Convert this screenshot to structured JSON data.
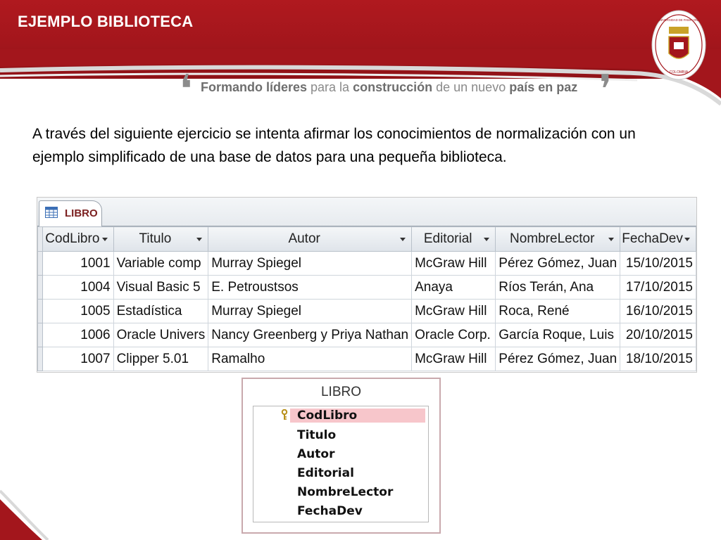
{
  "slide": {
    "title": "EJEMPLO BIBLIOTECA",
    "slogan": {
      "open_quote": "❛",
      "close_quote": "❜",
      "parts": [
        "Formando líderes",
        " para la ",
        "construcción",
        " de un nuevo ",
        "país en paz"
      ]
    },
    "seal_text": [
      "UNIVERSIDAD DE PAMPLONA",
      "COLOMBIA"
    ],
    "intro": "A través del siguiente ejercicio se intenta afirmar los conocimientos de normalización con un ejemplo simplificado de una base de datos para una pequeña biblioteca."
  },
  "table": {
    "tab_label": "LIBRO",
    "tab_icon": "datasheet-table-icon",
    "columns": [
      "CodLibro",
      "Titulo",
      "Autor",
      "Editorial",
      "NombreLector",
      "FechaDev"
    ],
    "rows": [
      [
        "1001",
        "Variable comp",
        "Murray Spiegel",
        "McGraw Hill",
        "Pérez Gómez, Juan",
        "15/10/2015"
      ],
      [
        "1004",
        "Visual Basic 5",
        "E. Petroustsos",
        "Anaya",
        "Ríos Terán, Ana",
        "17/10/2015"
      ],
      [
        "1005",
        "Estadística",
        "Murray Spiegel",
        "McGraw Hill",
        "Roca, René",
        "16/10/2015"
      ],
      [
        "1006",
        "Oracle Univers",
        "Nancy Greenberg y Priya Nathan",
        "Oracle Corp.",
        "García Roque, Luis",
        "20/10/2015"
      ],
      [
        "1007",
        "Clipper 5.01",
        "Ramalho",
        "McGraw Hill",
        "Pérez Gómez, Juan",
        "18/10/2015"
      ]
    ]
  },
  "entity": {
    "title": "LIBRO",
    "primary_key_icon": "key-icon",
    "fields": [
      "CodLibro",
      "Titulo",
      "Autor",
      "Editorial",
      "NombreLector",
      "FechaDev"
    ]
  },
  "colors": {
    "brand_red": "#a3161c",
    "pk_highlight": "#f7c6cb"
  }
}
